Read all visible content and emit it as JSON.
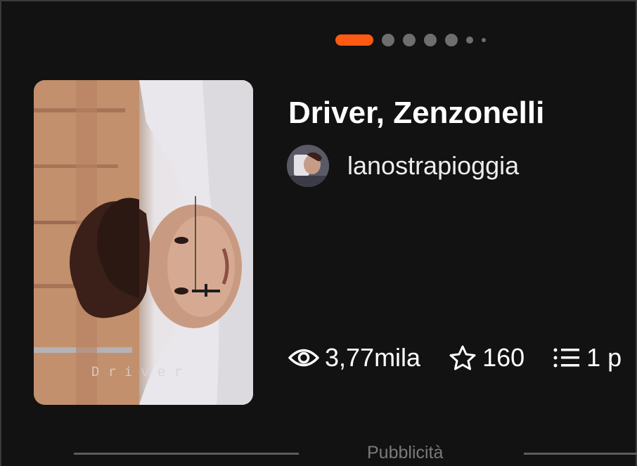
{
  "carousel": {
    "pages": 7,
    "active_index": 0
  },
  "cover": {
    "text": "Driver"
  },
  "story": {
    "title": "Driver, Zenzonelli",
    "author": "lanostrapioggia"
  },
  "stats": {
    "reads": "3,77mila",
    "votes": "160",
    "parts": "1 p"
  },
  "icons": {
    "reads": "eye-icon",
    "votes": "star-icon",
    "parts": "list-icon"
  },
  "ad": {
    "label": "Pubblicità"
  },
  "colors": {
    "background": "#121212",
    "accent": "#ff5a12",
    "dot_inactive": "#6e6e6e",
    "muted_text": "#7a7a7a"
  }
}
